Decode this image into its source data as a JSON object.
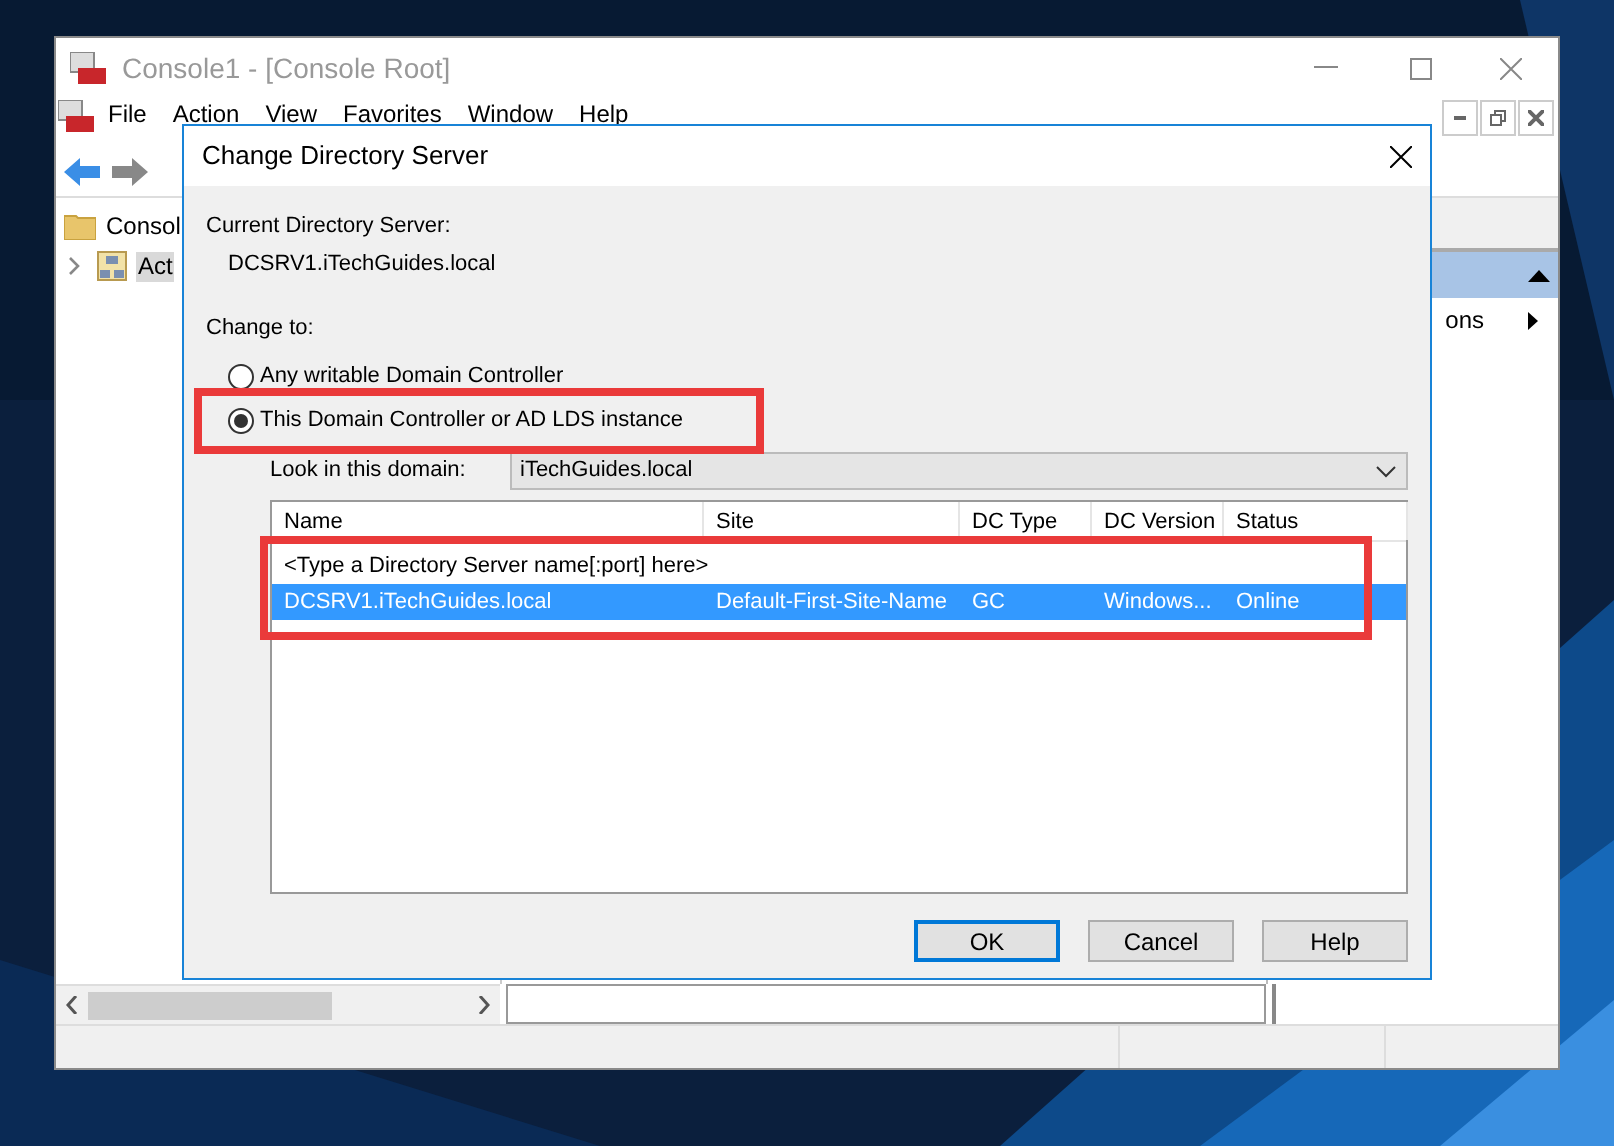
{
  "console": {
    "title": "Console1 - [Console Root]",
    "menu": [
      "File",
      "Action",
      "View",
      "Favorites",
      "Window",
      "Help"
    ],
    "tree": [
      {
        "label": "Consol",
        "selected": false,
        "children": [
          {
            "label": "Act",
            "selected": true,
            "expanded": false
          }
        ]
      }
    ],
    "actions": {
      "item": "ons"
    }
  },
  "dialog": {
    "title": "Change Directory Server",
    "current_label": "Current Directory Server:",
    "current_value": "DCSRV1.iTechGuides.local",
    "change_label": "Change to:",
    "options": [
      {
        "label": "Any writable Domain Controller",
        "selected": false
      },
      {
        "label": "This Domain Controller or AD LDS instance",
        "selected": true
      }
    ],
    "domain": {
      "label": "Look in this domain:",
      "value": "iTechGuides.local"
    },
    "list": {
      "columns": [
        "Name",
        "Site",
        "DC Type",
        "DC Version",
        "Status"
      ],
      "rows": [
        {
          "cells": [
            "<Type a Directory Server name[:port] here>"
          ],
          "selected": false
        },
        {
          "cells": [
            "DCSRV1.iTechGuides.local",
            "Default-First-Site-Name",
            "GC",
            "Windows...",
            "Online"
          ],
          "selected": true
        }
      ]
    },
    "buttons": [
      {
        "label": "OK",
        "default": true
      },
      {
        "label": "Cancel",
        "default": false
      },
      {
        "label": "Help",
        "default": false
      }
    ]
  }
}
